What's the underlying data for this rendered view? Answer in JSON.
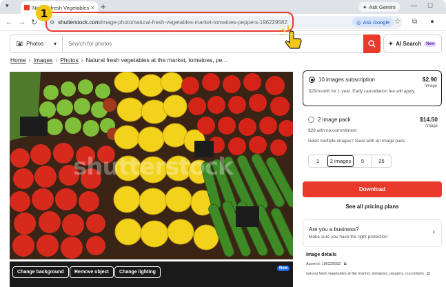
{
  "browser": {
    "tab_title": "Natural fresh Vegetables Ma",
    "tab_close": "×",
    "new_tab": "+",
    "ask_gemini_tab": "Ask Gemini",
    "url_host": "shutterstock.com",
    "url_path": "/image-photo/natural-fresh-vegetables-market-tomatoes-peppers-196229582",
    "ask_google": "Ask Google"
  },
  "annotation": {
    "step_number": "1"
  },
  "search": {
    "category": "Photos",
    "placeholder": "Search for photos",
    "ai_search_label": "AI Search",
    "ai_new_badge": "New"
  },
  "breadcrumb": {
    "items": [
      "Home",
      "Images",
      "Photos"
    ],
    "current": "Natural fresh vegetables at the market, tomatoes, pe..."
  },
  "image": {
    "watermark": "shutterstock",
    "tools": [
      "Change background",
      "Remove object",
      "Change lighting"
    ],
    "tools_new_badge": "New"
  },
  "pricing": {
    "subscription": {
      "title": "10 images subscription",
      "price": "$2.90",
      "unit": "/image",
      "desc": "$29/month for 1 year. Early cancellation fee will apply."
    },
    "pack": {
      "title": "2 image pack",
      "price": "$14.50",
      "unit": "/image",
      "desc": "$29 with no commitment",
      "more": "Need multiple images? Save with an image pack.",
      "sizes": [
        "1",
        "2 images",
        "5",
        "25"
      ]
    },
    "download_label": "Download",
    "see_all": "See all pricing plans"
  },
  "business": {
    "title": "Are you a business?",
    "subtitle": "Make sure you have the right protection"
  },
  "details": {
    "heading": "Image details",
    "asset_id": "Asset id: 196229582",
    "description": "natural fresh vegetables at the market, tomatoes, peppers, cucumbers"
  },
  "colors": {
    "brand_red": "#e8392a",
    "annotation_yellow": "#f5c518",
    "selected_border": "#222222"
  }
}
